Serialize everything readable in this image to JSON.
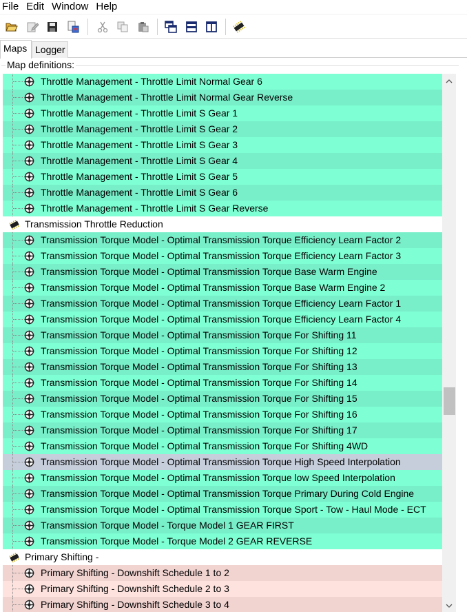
{
  "menu": [
    "File",
    "Edit",
    "Window",
    "Help"
  ],
  "toolbar": {
    "buttons": [
      "open-folder-icon",
      "edit-file-icon",
      "save-icon",
      "save-as-icon",
      "cut-icon",
      "copy-icon",
      "paste-icon",
      "cascade-windows-icon",
      "tile-horizontal-icon",
      "tile-vertical-icon",
      "ecu-chip-icon"
    ]
  },
  "tabs": [
    "Maps",
    "Logger"
  ],
  "group_label": "Map definitions:",
  "colors": {
    "green_a": "#7fffd4",
    "green_b": "#78eec9",
    "selected": "#c6cedb",
    "pink_a": "#f1d3d0",
    "pink_b": "#fde2de",
    "white": "#ffffff"
  },
  "tree": {
    "rows": [
      {
        "type": "leaf",
        "label": "Throttle Management - Throttle Limit Normal Gear 6",
        "bg": "green_a"
      },
      {
        "type": "leaf",
        "label": "Throttle Management - Throttle Limit Normal Gear Reverse",
        "bg": "green_b"
      },
      {
        "type": "leaf",
        "label": "Throttle Management - Throttle Limit S Gear 1",
        "bg": "green_a"
      },
      {
        "type": "leaf",
        "label": "Throttle Management - Throttle Limit S Gear 2",
        "bg": "green_b"
      },
      {
        "type": "leaf",
        "label": "Throttle Management - Throttle Limit S Gear 3",
        "bg": "green_a"
      },
      {
        "type": "leaf",
        "label": "Throttle Management - Throttle Limit S Gear 4",
        "bg": "green_b"
      },
      {
        "type": "leaf",
        "label": "Throttle Management - Throttle Limit S Gear 5",
        "bg": "green_a"
      },
      {
        "type": "leaf",
        "label": "Throttle Management - Throttle Limit S Gear 6",
        "bg": "green_b"
      },
      {
        "type": "leaf",
        "label": "Throttle Management - Throttle Limit S Gear Reverse",
        "bg": "green_a"
      },
      {
        "type": "cat",
        "label": "Transmission Throttle Reduction",
        "bg": "white"
      },
      {
        "type": "leaf",
        "label": "Transmission Torque Model - Optimal Transmission Torque  Efficiency Learn Factor 2",
        "bg": "green_b"
      },
      {
        "type": "leaf",
        "label": "Transmission Torque Model - Optimal Transmission Torque  Efficiency Learn Factor 3",
        "bg": "green_a"
      },
      {
        "type": "leaf",
        "label": "Transmission Torque Model - Optimal Transmission Torque Base Warm Engine",
        "bg": "green_b"
      },
      {
        "type": "leaf",
        "label": "Transmission Torque Model - Optimal Transmission Torque Base Warm Engine 2",
        "bg": "green_a"
      },
      {
        "type": "leaf",
        "label": "Transmission Torque Model - Optimal Transmission Torque Efficiency Learn Factor 1",
        "bg": "green_b"
      },
      {
        "type": "leaf",
        "label": "Transmission Torque Model - Optimal Transmission Torque Efficiency Learn Factor 4",
        "bg": "green_a"
      },
      {
        "type": "leaf",
        "label": "Transmission Torque Model - Optimal Transmission Torque For Shifting 11",
        "bg": "green_b"
      },
      {
        "type": "leaf",
        "label": "Transmission Torque Model - Optimal Transmission Torque For Shifting 12",
        "bg": "green_a"
      },
      {
        "type": "leaf",
        "label": "Transmission Torque Model - Optimal Transmission Torque For Shifting 13",
        "bg": "green_b"
      },
      {
        "type": "leaf",
        "label": "Transmission Torque Model - Optimal Transmission Torque For Shifting 14",
        "bg": "green_a"
      },
      {
        "type": "leaf",
        "label": "Transmission Torque Model - Optimal Transmission Torque For Shifting 15",
        "bg": "green_b"
      },
      {
        "type": "leaf",
        "label": "Transmission Torque Model - Optimal Transmission Torque For Shifting 16",
        "bg": "green_a"
      },
      {
        "type": "leaf",
        "label": "Transmission Torque Model - Optimal Transmission Torque For Shifting 17",
        "bg": "green_b"
      },
      {
        "type": "leaf",
        "label": "Transmission Torque Model - Optimal Transmission Torque For Shifting 4WD",
        "bg": "green_a"
      },
      {
        "type": "leaf",
        "label": "Transmission Torque Model - Optimal Transmission Torque High Speed Interpolation",
        "bg": "selected"
      },
      {
        "type": "leaf",
        "label": "Transmission Torque Model - Optimal Transmission Torque low Speed Interpolation",
        "bg": "green_a"
      },
      {
        "type": "leaf",
        "label": "Transmission Torque Model - Optimal Transmission Torque Primary During Cold Engine",
        "bg": "green_b"
      },
      {
        "type": "leaf",
        "label": "Transmission Torque Model - Optimal Transmission Torque Sport - Tow - Haul Mode - ECT",
        "bg": "green_a"
      },
      {
        "type": "leaf",
        "label": "Transmission Torque Model - Torque Model 1 GEAR FIRST",
        "bg": "green_b"
      },
      {
        "type": "leaf",
        "label": "Transmission Torque Model - Torque Model 2 GEAR REVERSE",
        "bg": "green_a"
      },
      {
        "type": "cat",
        "label": "Primary Shifting -",
        "bg": "white"
      },
      {
        "type": "leaf",
        "label": "Primary Shifting - Downshift Schedule 1 to 2",
        "bg": "pink_a"
      },
      {
        "type": "leaf",
        "label": "Primary Shifting - Downshift Schedule 2 to 3",
        "bg": "pink_b"
      },
      {
        "type": "leaf",
        "label": "Primary Shifting - Downshift Schedule 3 to 4",
        "bg": "pink_a"
      }
    ]
  },
  "scrollbar": {
    "position": 0.62
  }
}
